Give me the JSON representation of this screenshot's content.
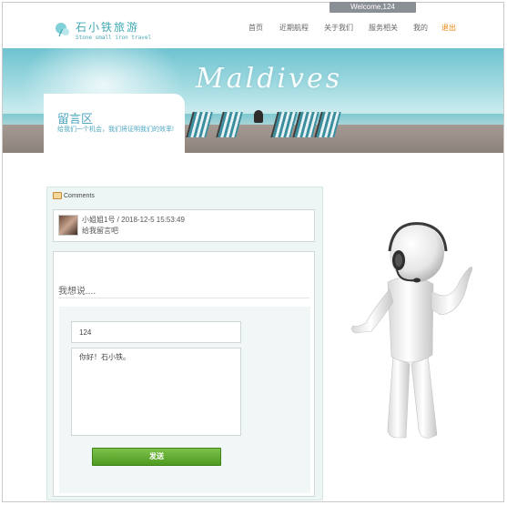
{
  "header": {
    "welcome": "Welcome,124",
    "logo_title": "石小铁旅游",
    "logo_subtitle": "Stone small iron travel",
    "nav": [
      {
        "label": "首页"
      },
      {
        "label": "近期航程"
      },
      {
        "label": "关于我们"
      },
      {
        "label": "服务相关"
      },
      {
        "label": "我的"
      },
      {
        "label": "退出"
      }
    ]
  },
  "banner": {
    "script_text": "Maldives",
    "card_title": "留言区",
    "card_subtitle": "给我们一个机会，我们将证明我们的效率!"
  },
  "comments": {
    "header": "Comments",
    "items": [
      {
        "meta": "小姐姐1号 / 2018-12-5 15:53:49",
        "text": "给我留言吧"
      }
    ]
  },
  "form": {
    "title": "我想说....",
    "name_value": "124",
    "message_value": "你好！石小铁。",
    "submit_label": "发送"
  },
  "colors": {
    "accent": "#3fa9b5",
    "logout": "#e8850c",
    "submit": "#5ea82c"
  },
  "icons": [
    "logo-icon",
    "comments-icon",
    "avatar",
    "support-agent-figure"
  ]
}
